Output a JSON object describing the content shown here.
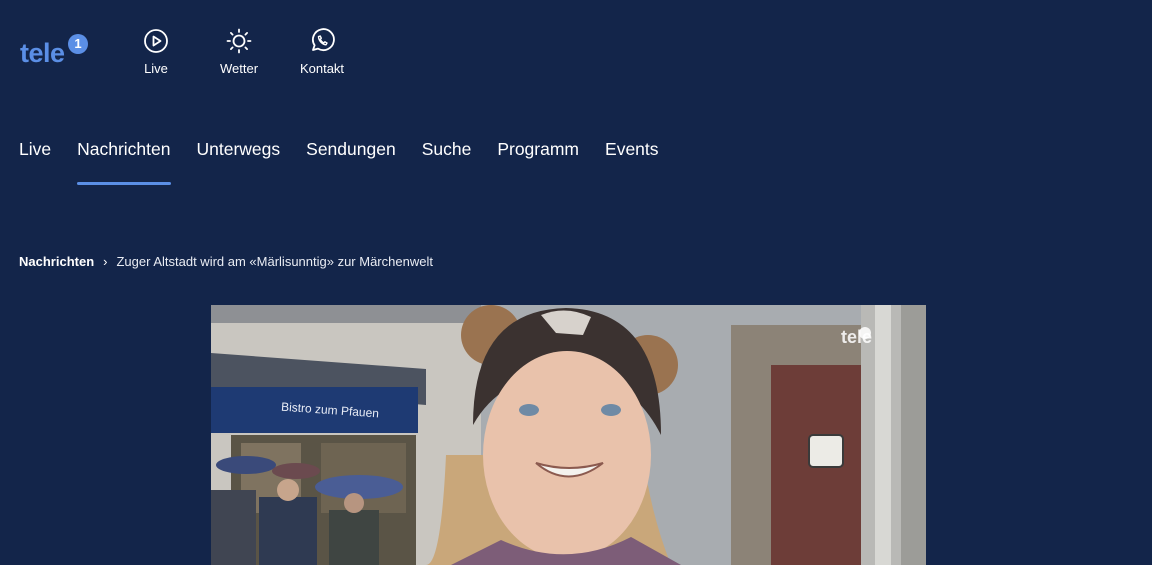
{
  "brand": {
    "logo_text": "tele",
    "logo_badge": "1",
    "accent": "#5b8fe6",
    "bg": "#13254a"
  },
  "quick_links": [
    {
      "label": "Live",
      "icon": "play-circle-icon"
    },
    {
      "label": "Wetter",
      "icon": "sun-icon"
    },
    {
      "label": "Kontakt",
      "icon": "whatsapp-phone-icon"
    }
  ],
  "main_nav": [
    {
      "label": "Live",
      "active": false
    },
    {
      "label": "Nachrichten",
      "active": true
    },
    {
      "label": "Unterwegs",
      "active": false
    },
    {
      "label": "Sendungen",
      "active": false
    },
    {
      "label": "Suche",
      "active": false
    },
    {
      "label": "Programm",
      "active": false
    },
    {
      "label": "Events",
      "active": false
    }
  ],
  "breadcrumb": {
    "parent": "Nachrichten",
    "separator": "›",
    "current": "Zuger Altstadt wird am «Märlisunntig» zur Märchenwelt"
  },
  "video": {
    "watermark": "tele",
    "storefront_sign": "Bistro zum Pfauen"
  }
}
